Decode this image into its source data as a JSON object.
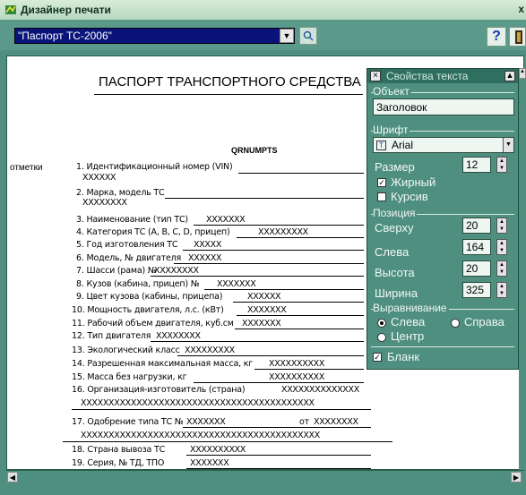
{
  "window": {
    "title": "Дизайнер печати",
    "close_glyph": "x"
  },
  "toolbar": {
    "template_selected": "\"Паспорт ТС-2006\"",
    "help_label": "?"
  },
  "document": {
    "title": "ПАСПОРТ ТРАНСПОРТНОГО СРЕДСТВА",
    "barcode_label": "QRNUMPTS",
    "marks_label": "отметки",
    "fields": [
      {
        "label": "1. Идентификационный номер (VIN)",
        "value": "XXXXXX"
      },
      {
        "label": "2. Марка, модель ТС",
        "value": "XXXXXXXX"
      },
      {
        "label": "3. Наименование (тип ТС)",
        "value": "XXXXXXX"
      },
      {
        "label": "4. Категория ТС (A, B, C, D, прицеп)",
        "value": "XXXXXXXXX"
      },
      {
        "label": "5. Год изготовления ТС",
        "value": "XXXXX"
      },
      {
        "label": "6. Модель, № двигателя",
        "value": "XXXXXX"
      },
      {
        "label": "7. Шасси (рама) №",
        "value": "XXXXXXXX"
      },
      {
        "label": "8. Кузов (кабина, прицеп) №",
        "value": "XXXXXXX"
      },
      {
        "label": "9. Цвет кузова (кабины, прицепа)",
        "value": "XXXXXX"
      },
      {
        "label": "10. Мощность двигателя, л.с. (кВт)",
        "value": "XXXXXXX"
      },
      {
        "label": "11. Рабочий объем двигателя, куб.см",
        "value": "XXXXXXX"
      },
      {
        "label": "12. Тип двигателя",
        "value": "XXXXXXXX"
      },
      {
        "label": "13. Экологический класс",
        "value": "XXXXXXXXX"
      },
      {
        "label": "14. Разрешенная максимальная масса, кг",
        "value": "XXXXXXXXXX"
      },
      {
        "label": "15. Масса без нагрузки, кг",
        "value": "XXXXXXXXXX"
      },
      {
        "label": "16. Организация-изготовитель (страна)",
        "value": "XXXXXXXXXXXXXX"
      },
      {
        "label": "17. Одобрение типа ТС №",
        "value": "XXXXXXX"
      },
      {
        "label": "18. Страна вывоза ТС",
        "value": "XXXXXXXXXX"
      },
      {
        "label": "19. Серия, № ТД, ТПО",
        "value": "XXXXXXX"
      }
    ],
    "field16_line2": "XXXXXXXXXXXXXXXXXXXXXXXXXXXXXXXXXXXXXXXXXX",
    "field17_from": "от",
    "field17_from_value": "XXXXXXXX",
    "field17_line2": "XXXXXXXXXXXXXXXXXXXXXXXXXXXXXXXXXXXXXXXXXXX"
  },
  "properties": {
    "title": "Свойства текста",
    "object_group": "Объект",
    "object_value": "Заголовок",
    "font_group": "Шрифт",
    "font_value": "Arial",
    "size_label": "Размер",
    "size_value": "12",
    "bold_label": "Жирный",
    "bold_checked": true,
    "italic_label": "Курсив",
    "italic_checked": false,
    "position_group": "Позиция",
    "top_label": "Сверху",
    "top_value": "20",
    "left_label": "Слева",
    "left_value": "164",
    "height_label": "Высота",
    "height_value": "20",
    "width_label": "Ширина",
    "width_value": "325",
    "align_group": "Выравнивание",
    "align_left": "Слева",
    "align_right": "Справа",
    "align_center": "Центр",
    "align_selected": "left",
    "blank_label": "Бланк",
    "blank_checked": true
  },
  "colors": {
    "window_bg": "#4f8f7f",
    "titlebar": "#c8e4cc",
    "combo_bg": "#0a1478",
    "panel_head": "#2f6f5f"
  }
}
